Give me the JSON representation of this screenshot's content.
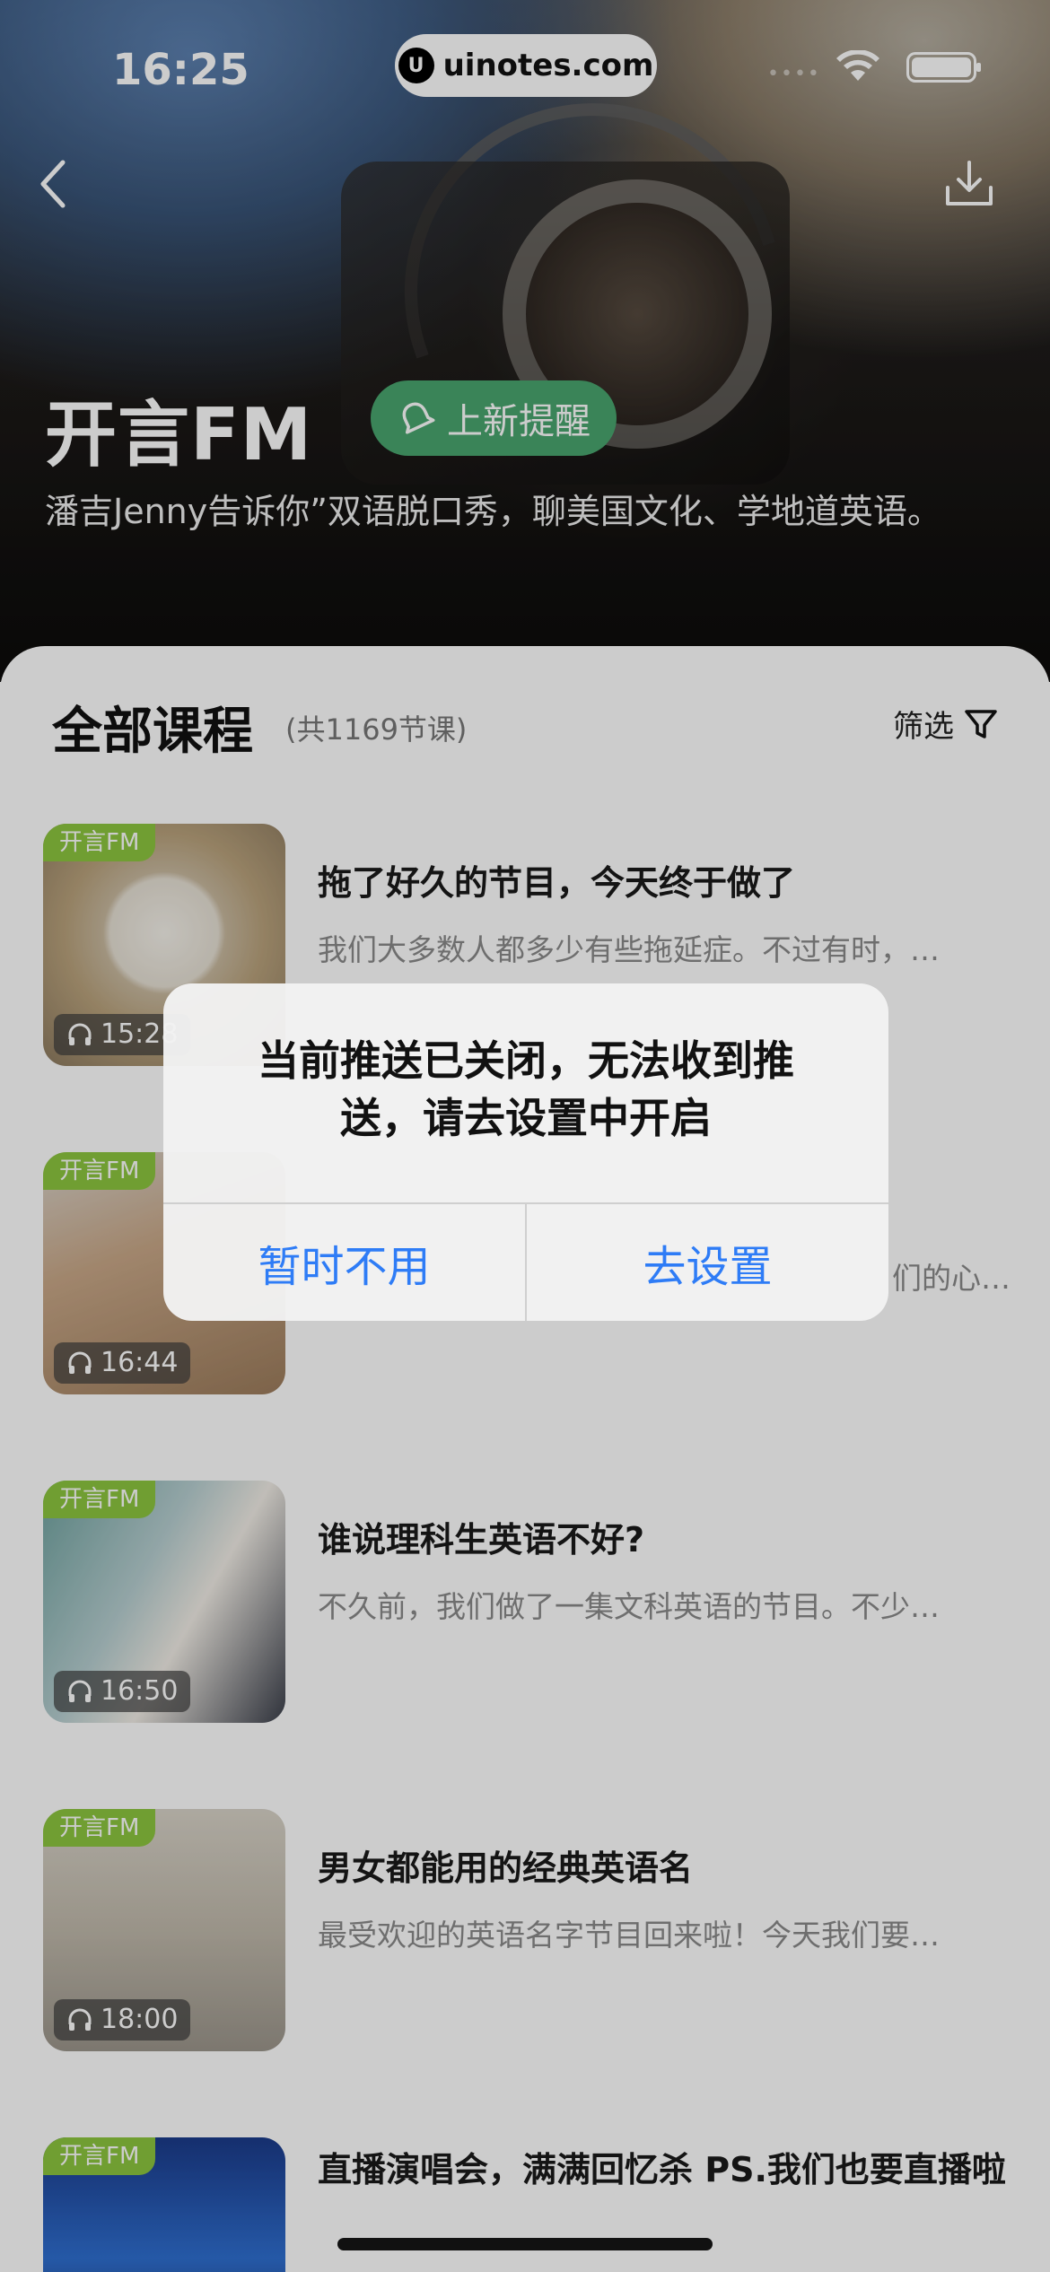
{
  "status_bar": {
    "time": "16:25",
    "url": "uinotes.com"
  },
  "header": {
    "title": "开言FM",
    "remind_label": "上新提醒",
    "description": "潘吉Jenny告诉你”双语脱口秀，聊美国文化、学地道英语。"
  },
  "section": {
    "title": "全部课程",
    "count": "(共1169节课)",
    "filter_label": "筛选"
  },
  "courses": [
    {
      "tag": "开言FM",
      "duration": "15:28",
      "title": "拖了好久的节目，今天终于做了",
      "desc": "我们大多数人都多少有些拖延症。不过有时，…"
    },
    {
      "tag": "开言FM",
      "duration": "16:44",
      "title": "",
      "desc": "们的心…"
    },
    {
      "tag": "开言FM",
      "duration": "16:50",
      "title": "谁说理科生英语不好?",
      "desc": "不久前，我们做了一集文科英语的节目。不少…"
    },
    {
      "tag": "开言FM",
      "duration": "18:00",
      "title": "男女都能用的经典英语名",
      "desc": "最受欢迎的英语名字节目回来啦！今天我们要…"
    },
    {
      "tag": "开言FM",
      "duration": "",
      "title": "直播演唱会，满满回忆杀 PS.我们也要直播啦",
      "desc": ""
    }
  ],
  "dialog": {
    "message": "当前推送已关闭，无法收到推送，请去设置中开启",
    "cancel_label": "暂时不用",
    "confirm_label": "去设置"
  },
  "colors": {
    "accent_green": "#49a66e",
    "tag_green": "#8cc63f",
    "dialog_button_blue": "#2e7cf6"
  }
}
